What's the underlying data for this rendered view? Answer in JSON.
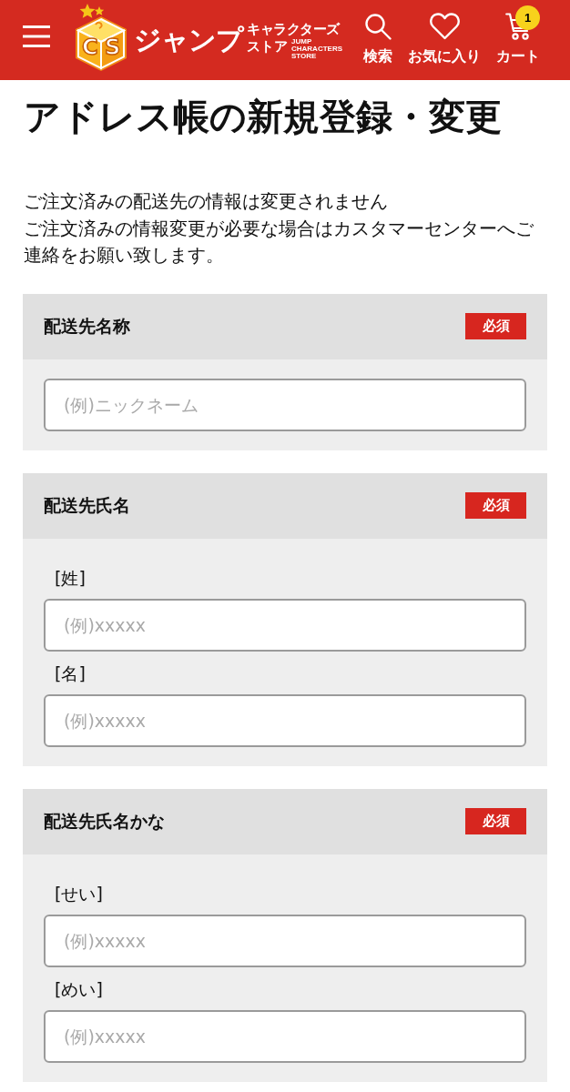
{
  "header": {
    "logo": {
      "cube_letters": [
        "C",
        "S"
      ],
      "main": "ジャンプ",
      "sub_top": "キャラクターズ",
      "sub_bottom": "ストア",
      "english": [
        "JUMP",
        "CHARACTERS",
        "STORE"
      ]
    },
    "nav": [
      {
        "kind": "search",
        "label": "検索"
      },
      {
        "kind": "favorite",
        "label": "お気に入り"
      },
      {
        "kind": "cart",
        "label": "カート",
        "badge": "1"
      }
    ]
  },
  "page_title": "アドレス帳の新規登録・変更",
  "notice": [
    "ご注文済みの配送先の情報は変更されません",
    "ご注文済みの情報変更が必要な場合はカスタマーセンターへご連絡をお願い致します。"
  ],
  "sections": [
    {
      "title": "配送先名称",
      "badge": "必須",
      "fields": [
        {
          "placeholder": "(例)ニックネーム"
        }
      ]
    },
    {
      "title": "配送先氏名",
      "badge": "必須",
      "fields": [
        {
          "label": "[姓]",
          "placeholder": "(例)xxxxx"
        },
        {
          "label": "[名]",
          "placeholder": "(例)xxxxx"
        }
      ]
    },
    {
      "title": "配送先氏名かな",
      "badge": "必須",
      "fields": [
        {
          "label": "[せい]",
          "placeholder": "(例)xxxxx"
        },
        {
          "label": "[めい]",
          "placeholder": "(例)xxxxx"
        }
      ]
    }
  ]
}
